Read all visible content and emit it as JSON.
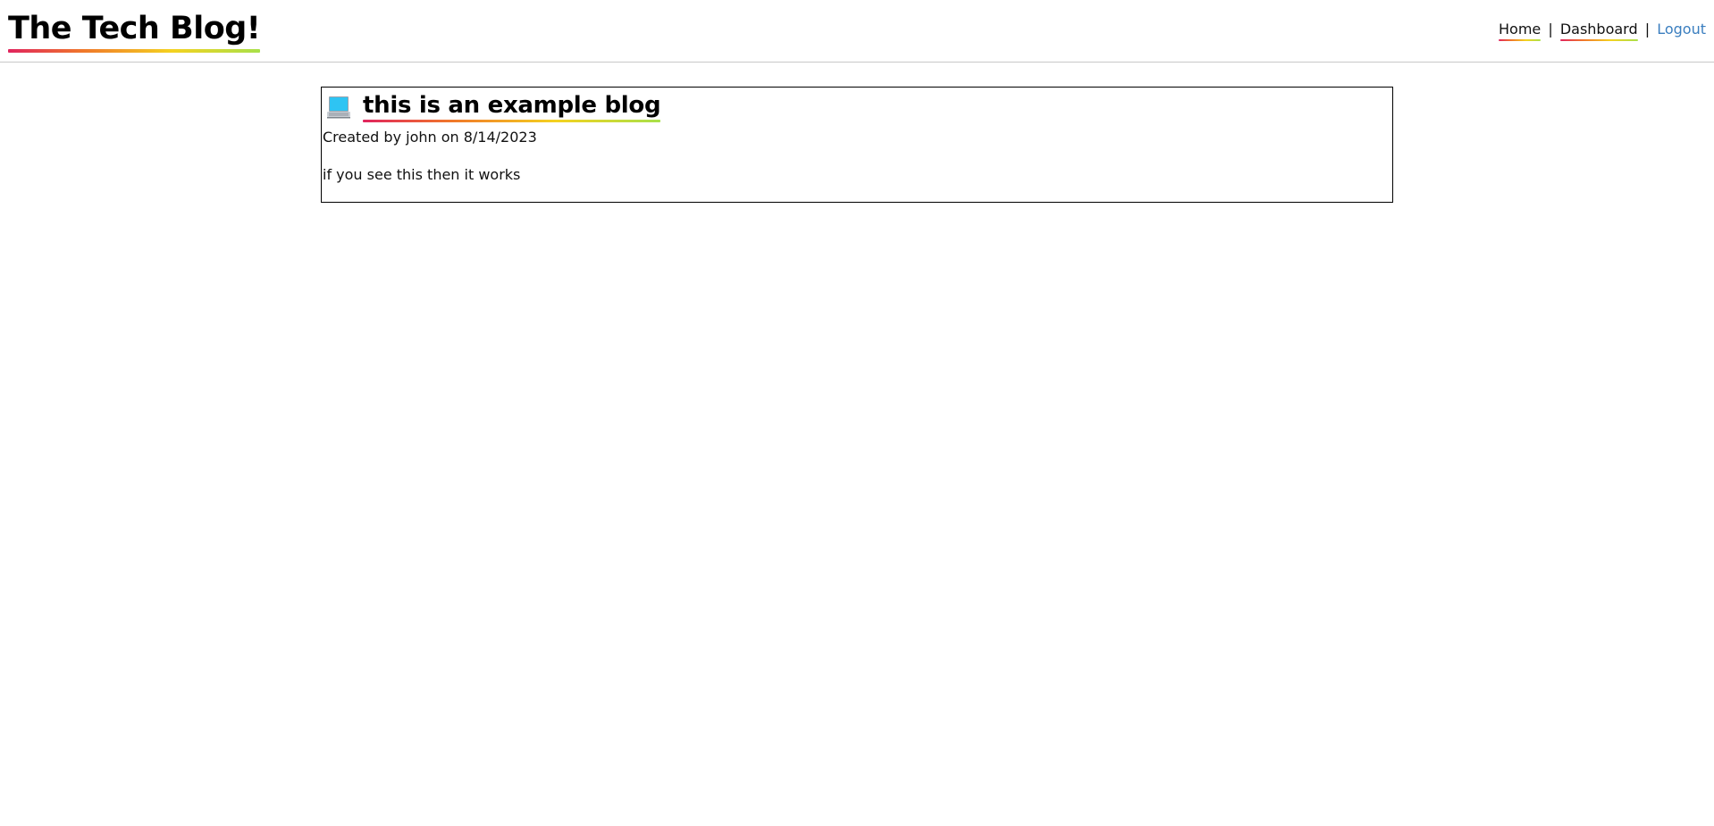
{
  "header": {
    "site_title": "The Tech Blog!",
    "nav": {
      "home": "Home",
      "dashboard": "Dashboard",
      "logout": "Logout",
      "separator": "|"
    }
  },
  "post": {
    "icon": "computer-icon",
    "title": "this is an example blog",
    "meta": "Created by john on 8/14/2023",
    "body": "if you see this then it works"
  },
  "colors": {
    "underline_gradient": [
      "#e0245e",
      "#f0782a",
      "#f4d220",
      "#a8e04a"
    ],
    "logout_link": "#3a7ebf",
    "header_border": "#c8c8c8"
  }
}
